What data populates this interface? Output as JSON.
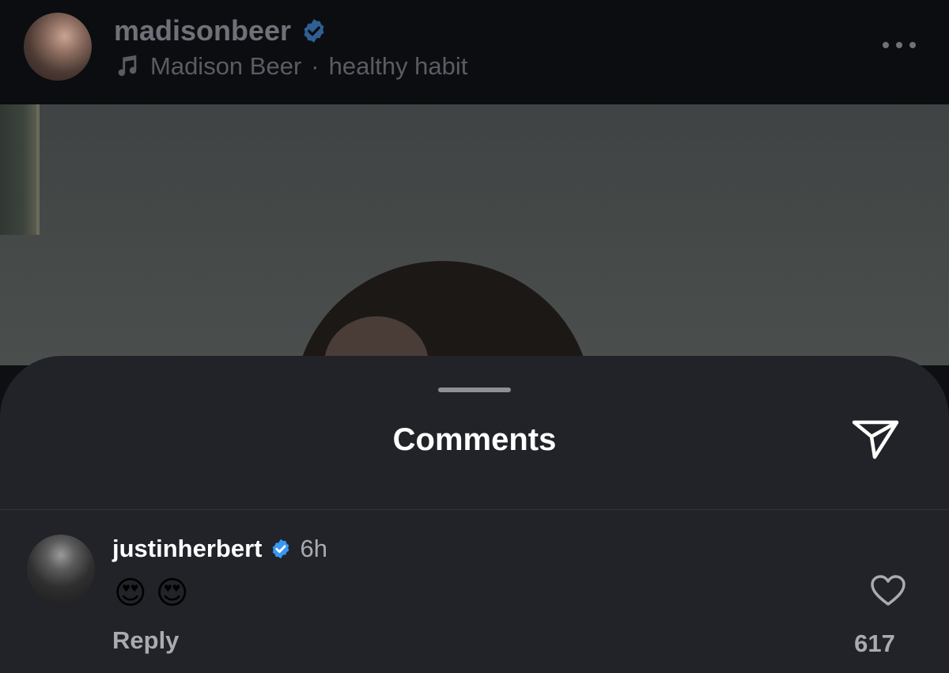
{
  "header": {
    "username": "madisonbeer",
    "music_artist": "Madison Beer",
    "music_separator": "·",
    "music_track": "healthy habit",
    "icons": {
      "verified": "verified-badge-icon",
      "music": "music-note-icon",
      "more": "more-options-icon"
    }
  },
  "sheet": {
    "title": "Comments",
    "share_icon": "send-icon"
  },
  "comments": [
    {
      "username": "justinherbert",
      "time": "6h",
      "text": "😍 😍",
      "reply_label": "Reply",
      "like_count": "617"
    }
  ],
  "colors": {
    "verified_blue": "#3897f0",
    "sheet_bg": "#212328",
    "header_bg": "#0b0d10"
  }
}
